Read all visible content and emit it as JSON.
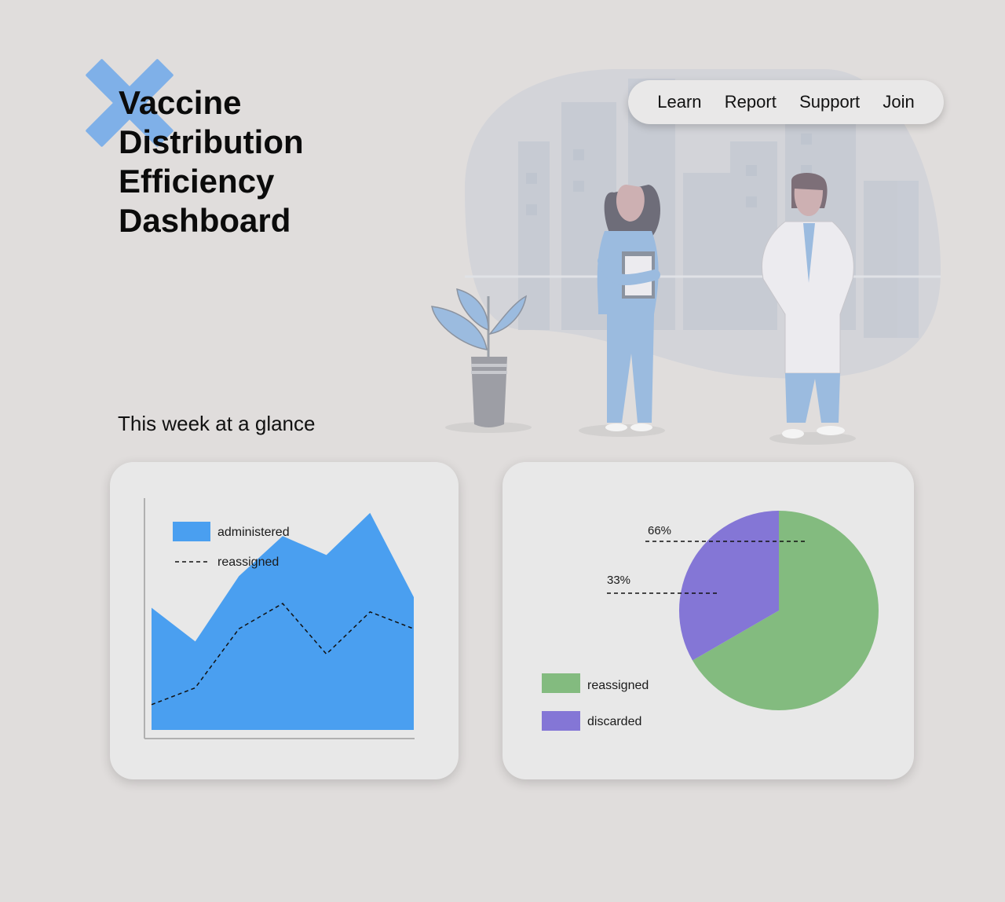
{
  "header": {
    "title_lines": [
      "Vaccine",
      "Distribution",
      "Efficiency",
      "Dashboard"
    ],
    "logo_icon": "x-cross-icon"
  },
  "nav": {
    "items": [
      {
        "label": "Learn"
      },
      {
        "label": "Report"
      },
      {
        "label": "Support"
      },
      {
        "label": "Join"
      }
    ]
  },
  "section": {
    "title": "This week at a glance"
  },
  "colors": {
    "background": "#e0dddc",
    "card": "#e8e8e8",
    "administered": "#4a9ff0",
    "reassigned_pie": "#83bb7f",
    "discarded_pie": "#8476d6",
    "logo": "#7fb0e8"
  },
  "chart_data": [
    {
      "type": "area",
      "title": "",
      "xlabel": "",
      "ylabel": "",
      "legend_position": "top-left",
      "series": [
        {
          "name": "administered",
          "style": "area",
          "values": [
            58,
            42,
            73,
            92,
            83,
            103,
            63
          ]
        },
        {
          "name": "reassigned",
          "style": "dashed-line",
          "values": [
            12,
            20,
            48,
            60,
            36,
            56,
            48
          ]
        }
      ],
      "ylim": [
        0,
        110
      ]
    },
    {
      "type": "pie",
      "title": "",
      "legend_position": "bottom-left",
      "slices": [
        {
          "name": "reassigned",
          "value": 66,
          "label": "66%"
        },
        {
          "name": "discarded",
          "value": 33,
          "label": "33%"
        }
      ]
    }
  ]
}
